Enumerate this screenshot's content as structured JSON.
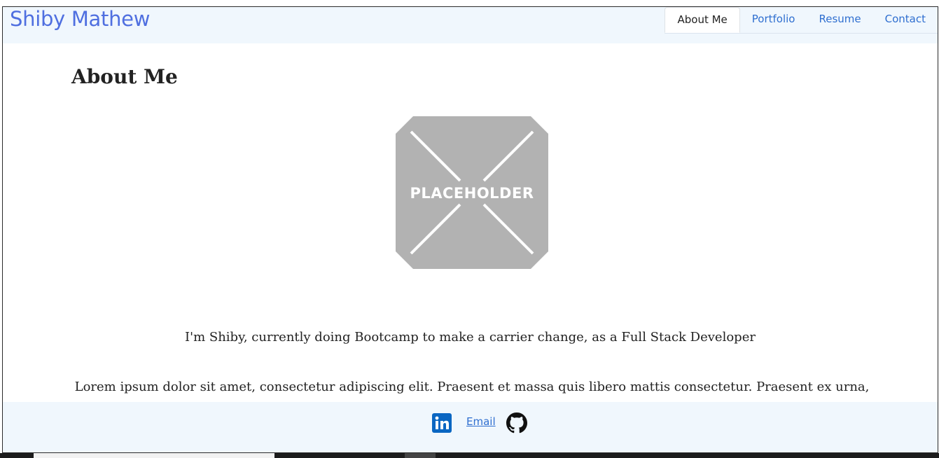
{
  "header": {
    "brand": "Shiby Mathew",
    "nav": [
      {
        "label": "About Me",
        "active": true
      },
      {
        "label": "Portfolio",
        "active": false
      },
      {
        "label": "Resume",
        "active": false
      },
      {
        "label": "Contact",
        "active": false
      }
    ]
  },
  "main": {
    "heading": "About Me",
    "placeholder_text": "PLACEHOLDER",
    "intro": "I'm Shiby, currently doing Bootcamp to make a carrier change, as a Full Stack Developer",
    "lorem": "Lorem ipsum dolor sit amet, consectetur adipiscing elit. Praesent et massa quis libero mattis consectetur. Praesent ex urna, ultrices vel.This is Project Page Lorem ipsum dolor sit amet, consectetur adipiscing elit. Praesent et massa quis libero mattis consectetur. Praesent ex urna,"
  },
  "footer": {
    "email_label": "Email",
    "icons": [
      "linkedin-icon",
      "github-icon"
    ]
  },
  "colors": {
    "brand": "#4f6fe0",
    "link": "#2f6fd0",
    "header_bg": "#f0f7fd",
    "linkedin": "#0a66c2"
  }
}
